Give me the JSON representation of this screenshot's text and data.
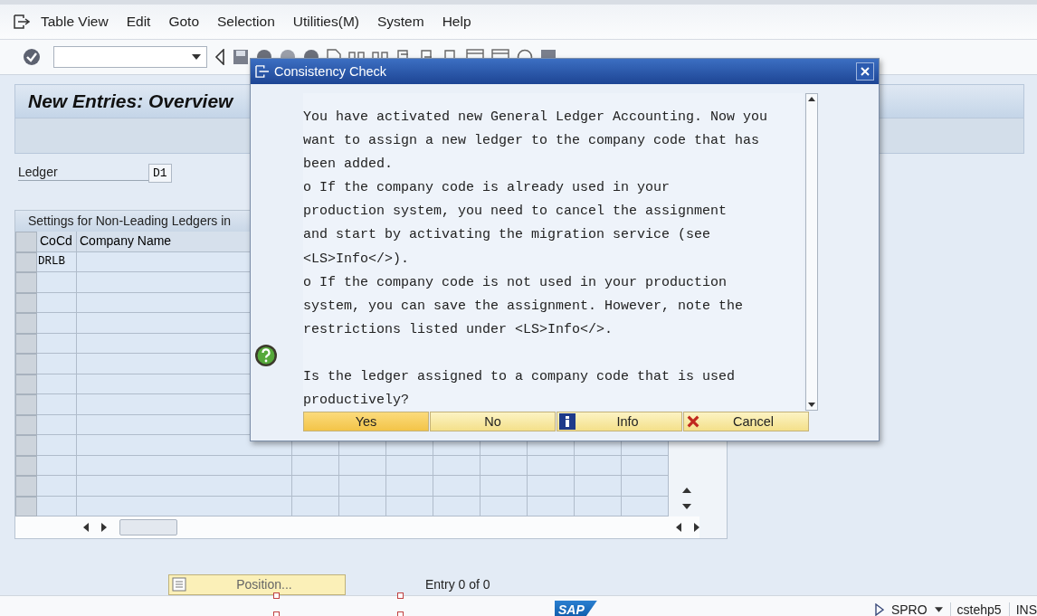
{
  "menu_bar": {
    "items": [
      "Table View",
      "Edit",
      "Goto",
      "Selection",
      "Utilities(M)",
      "System",
      "Help"
    ]
  },
  "screen": {
    "title": "New Entries: Overview",
    "ledger": {
      "label": "Ledger",
      "value": "D1"
    },
    "table": {
      "title": "Settings for Non-Leading Ledgers in",
      "columns": [
        "CoCd",
        "Company Name"
      ],
      "rows": [
        {
          "cocd": "DRLB"
        }
      ]
    },
    "position_button": "Position...",
    "entry_count": "Entry 0 of 0"
  },
  "dialog": {
    "title": "Consistency Check",
    "paragraphs": [
      "You have activated new General Ledger Accounting. Now you\nwant to assign a new ledger to the company code that has\nbeen added.",
      "o If the company code is already used in your\nproduction system, you need to cancel the assignment\nand start by activating the migration service (see\n<LS>Info</>).",
      "o If the company code is not used in your production\nsystem, you can save the assignment. However, note the\nrestrictions listed under <LS>Info</>."
    ],
    "question": "Is the ledger assigned to a company code that is used\nproductively?",
    "buttons": [
      {
        "label": "Yes",
        "kind": "plain",
        "selected": true
      },
      {
        "label": "No",
        "kind": "plain",
        "selected": false
      },
      {
        "label": "Info",
        "kind": "info",
        "selected": false
      },
      {
        "label": "Cancel",
        "kind": "cancel",
        "selected": false
      }
    ]
  },
  "status_bar": {
    "logo": "SAP",
    "transaction": "SPRO",
    "server": "cstehp5",
    "mode": "INS"
  }
}
